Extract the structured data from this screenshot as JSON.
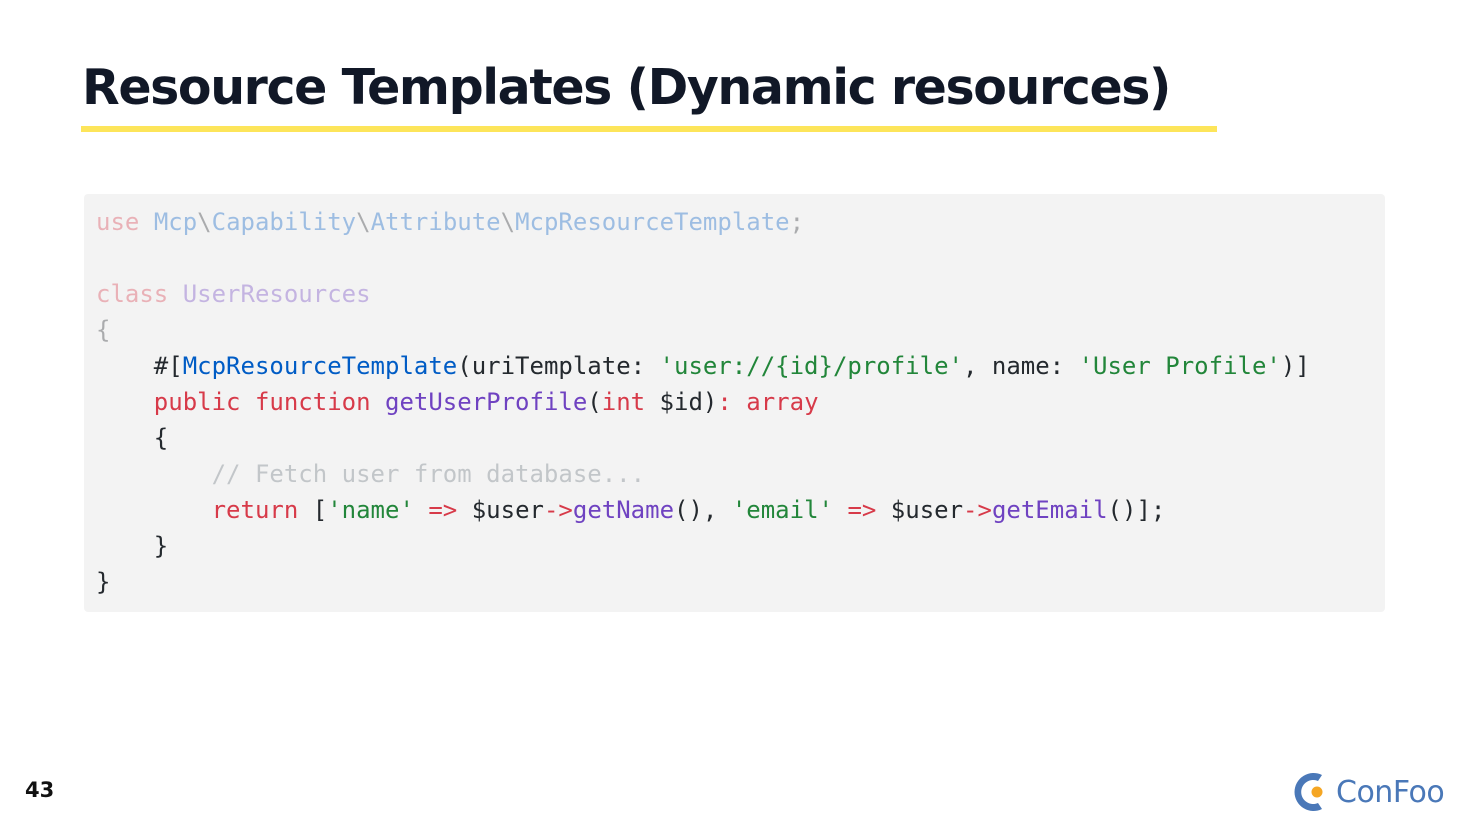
{
  "slide": {
    "title": "Resource Templates (Dynamic resources)",
    "page_number": "43",
    "logo_text": "ConFoo",
    "accent_color": "#fde55a",
    "logo_color": "#4a78b8",
    "logo_dot_color": "#f5a623"
  },
  "code": {
    "language": "php",
    "lines": [
      {
        "dim": true,
        "tokens": [
          {
            "t": "use",
            "c": "kw"
          },
          {
            "t": " ",
            "c": "plain"
          },
          {
            "t": "Mcp",
            "c": "type"
          },
          {
            "t": "\\",
            "c": "plain"
          },
          {
            "t": "Capability",
            "c": "type"
          },
          {
            "t": "\\",
            "c": "plain"
          },
          {
            "t": "Attribute",
            "c": "type"
          },
          {
            "t": "\\",
            "c": "plain"
          },
          {
            "t": "McpResourceTemplate",
            "c": "type"
          },
          {
            "t": ";",
            "c": "plain"
          }
        ]
      },
      {
        "dim": true,
        "tokens": []
      },
      {
        "dim": true,
        "tokens": [
          {
            "t": "class",
            "c": "kw"
          },
          {
            "t": " ",
            "c": "plain"
          },
          {
            "t": "UserResources",
            "c": "cls"
          }
        ]
      },
      {
        "dim": true,
        "tokens": [
          {
            "t": "{",
            "c": "plain"
          }
        ]
      },
      {
        "dim": false,
        "tokens": [
          {
            "t": "    #[",
            "c": "plain"
          },
          {
            "t": "McpResourceTemplate",
            "c": "type"
          },
          {
            "t": "(uriTemplate: ",
            "c": "plain"
          },
          {
            "t": "'user://{id}/profile'",
            "c": "str"
          },
          {
            "t": ", name: ",
            "c": "plain"
          },
          {
            "t": "'User Profile'",
            "c": "str"
          },
          {
            "t": ")]",
            "c": "plain"
          }
        ]
      },
      {
        "dim": false,
        "tokens": [
          {
            "t": "    ",
            "c": "plain"
          },
          {
            "t": "public",
            "c": "kw"
          },
          {
            "t": " ",
            "c": "plain"
          },
          {
            "t": "function",
            "c": "kw"
          },
          {
            "t": " ",
            "c": "plain"
          },
          {
            "t": "getUserProfile",
            "c": "fn"
          },
          {
            "t": "(",
            "c": "plain"
          },
          {
            "t": "int",
            "c": "kw"
          },
          {
            "t": " $id)",
            "c": "plain"
          },
          {
            "t": ":",
            "c": "op"
          },
          {
            "t": " ",
            "c": "plain"
          },
          {
            "t": "array",
            "c": "kw"
          }
        ]
      },
      {
        "dim": false,
        "tokens": [
          {
            "t": "    {",
            "c": "plain"
          }
        ]
      },
      {
        "dim": false,
        "tokens": [
          {
            "t": "        ",
            "c": "plain"
          },
          {
            "t": "// Fetch user from database...",
            "c": "comment",
            "dim": true
          }
        ]
      },
      {
        "dim": false,
        "tokens": [
          {
            "t": "        ",
            "c": "plain"
          },
          {
            "t": "return",
            "c": "kw"
          },
          {
            "t": " [",
            "c": "plain"
          },
          {
            "t": "'name'",
            "c": "str"
          },
          {
            "t": " ",
            "c": "plain"
          },
          {
            "t": "=>",
            "c": "op"
          },
          {
            "t": " $user",
            "c": "plain"
          },
          {
            "t": "->",
            "c": "op"
          },
          {
            "t": "getName",
            "c": "fn"
          },
          {
            "t": "(), ",
            "c": "plain"
          },
          {
            "t": "'email'",
            "c": "str"
          },
          {
            "t": " ",
            "c": "plain"
          },
          {
            "t": "=>",
            "c": "op"
          },
          {
            "t": " $user",
            "c": "plain"
          },
          {
            "t": "->",
            "c": "op"
          },
          {
            "t": "getEmail",
            "c": "fn"
          },
          {
            "t": "()];",
            "c": "plain"
          }
        ]
      },
      {
        "dim": false,
        "tokens": [
          {
            "t": "    }",
            "c": "plain"
          }
        ]
      },
      {
        "dim": false,
        "tokens": [
          {
            "t": "}",
            "c": "plain"
          }
        ]
      }
    ]
  }
}
